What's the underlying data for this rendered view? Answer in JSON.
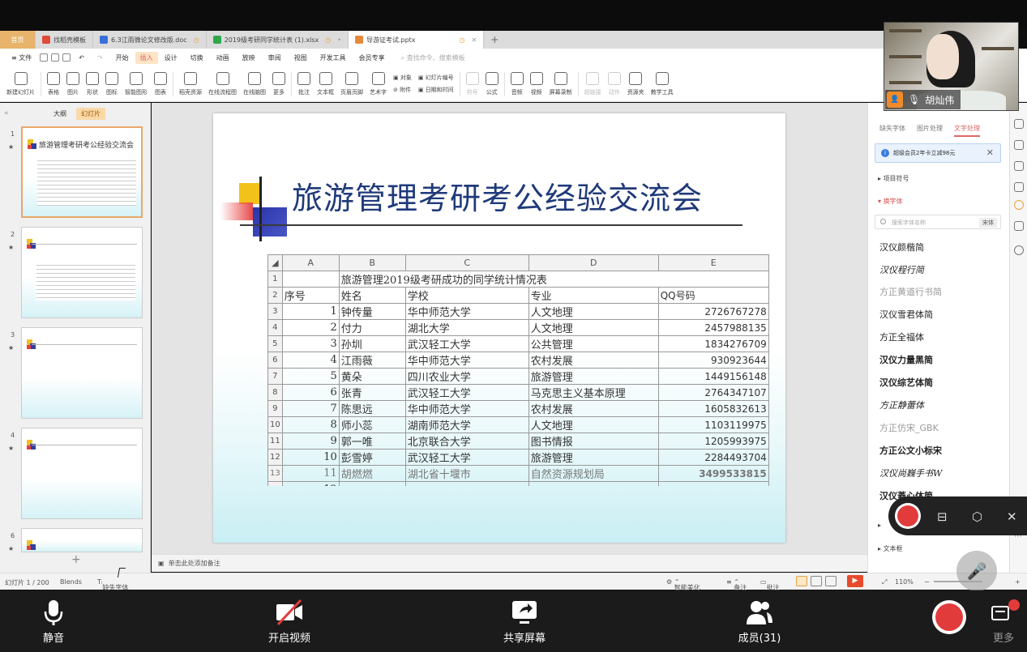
{
  "tabs": [
    {
      "label": "首页",
      "kind": "home"
    },
    {
      "label": "找稻壳模板",
      "kind": "normal"
    },
    {
      "label": "6.3江雨微论文修改版.doc",
      "kind": "normal"
    },
    {
      "label": "2019级考研同学统计表 (1).xlsx",
      "kind": "normal"
    },
    {
      "label": "导游证考试.pptx",
      "kind": "active"
    }
  ],
  "menu": {
    "file": "文件",
    "items": [
      "开始",
      "插入",
      "设计",
      "切换",
      "动画",
      "放映",
      "审阅",
      "视图",
      "开发工具",
      "会员专享"
    ],
    "selected": "插入",
    "search": "查找命令、搜索模板"
  },
  "ribbon": {
    "items": [
      "新建幻灯片",
      "表格",
      "图片",
      "形状",
      "图标",
      "智能图形",
      "图表",
      "稻壳资源",
      "在线流程图",
      "在线脑图",
      "更多",
      "批注",
      "文本框",
      "页眉页脚",
      "艺术字"
    ],
    "small_col1": [
      "对象",
      "附件"
    ],
    "small_col2": [
      "幻灯片编号",
      "日期和时间"
    ],
    "items2": [
      "符号",
      "公式",
      "音频",
      "视频",
      "屏幕录制",
      "超链接",
      "动作",
      "资源夹",
      "教学工具"
    ]
  },
  "left_panel": {
    "tab_outline": "大纲",
    "tab_slides": "幻灯片",
    "thumb_title": "旅游管理考研考公经验交流会",
    "slide_numbers": [
      "1",
      "2",
      "3",
      "4",
      "6"
    ]
  },
  "slide": {
    "title": "旅游管理考研考公经验交流会",
    "sheet": {
      "col_headers": [
        "A",
        "B",
        "C",
        "D",
        "E"
      ],
      "table_title": "旅游管理2019级考研成功的同学统计情况表",
      "headers": [
        "序号",
        "姓名",
        "学校",
        "专业",
        "QQ号码"
      ],
      "rows": [
        {
          "rn": "3",
          "no": "1",
          "name": "钟传量",
          "school": "华中师范大学",
          "major": "人文地理",
          "qq": "2726767278"
        },
        {
          "rn": "4",
          "no": "2",
          "name": "付力",
          "school": "湖北大学",
          "major": "人文地理",
          "qq": "2457988135"
        },
        {
          "rn": "5",
          "no": "3",
          "name": "孙圳",
          "school": "武汉轻工大学",
          "major": "公共管理",
          "qq": "1834276709"
        },
        {
          "rn": "6",
          "no": "4",
          "name": "江雨薇",
          "school": "华中师范大学",
          "major": "农村发展",
          "qq": "930923644"
        },
        {
          "rn": "7",
          "no": "5",
          "name": "黄朵",
          "school": "四川农业大学",
          "major": "旅游管理",
          "qq": "1449156148"
        },
        {
          "rn": "8",
          "no": "6",
          "name": "张青",
          "school": "武汉轻工大学",
          "major": "马克思主义基本原理",
          "qq": "2764347107"
        },
        {
          "rn": "9",
          "no": "7",
          "name": "陈思远",
          "school": "华中师范大学",
          "major": "农村发展",
          "qq": "1605832613"
        },
        {
          "rn": "10",
          "no": "8",
          "name": "师小蕊",
          "school": "湖南师范大学",
          "major": "人文地理",
          "qq": "1103119975"
        },
        {
          "rn": "11",
          "no": "9",
          "name": "郭一唯",
          "school": "北京联合大学",
          "major": "图书情报",
          "qq": "1205993975"
        },
        {
          "rn": "12",
          "no": "10",
          "name": "彭雪婷",
          "school": "武汉轻工大学",
          "major": "旅游管理",
          "qq": "2284493704"
        },
        {
          "rn": "13",
          "no": "11",
          "name": "胡燃燃",
          "school": "湖北省十堰市",
          "major": "自然资源规划局",
          "qq": "3499533815"
        },
        {
          "rn": "14",
          "no": "12",
          "name": "",
          "school": "",
          "major": "",
          "qq": ""
        }
      ]
    }
  },
  "notes_placeholder": "单击此处添加备注",
  "status": {
    "slide_count": "幻灯片 1 / 200",
    "theme": "Blends",
    "missing_font": "缺失字体",
    "smart": "智能美化",
    "notes": "备注",
    "comments": "批注",
    "zoom": "110%"
  },
  "right_panel": {
    "tabs": [
      "缺失字体",
      "图片处理",
      "文字处理"
    ],
    "active_tab": "文字处理",
    "vip_banner": "超级会员2年卡立减98元",
    "section_bullets": "项目符号",
    "section_fonts": "换字体",
    "font_search_placeholder": "搜索字体名称",
    "font_search_btn": "宋体",
    "fonts": [
      "汉仪颜楷简",
      "汉仪程行简",
      "方正黄道行书简",
      "汉仪雪君体简",
      "方正全福体",
      "汉仪力量黑简",
      "汉仪综艺体简",
      "方正静蕾体",
      "方正仿宋_GBK",
      "方正公文小标宋",
      "汉仪尚巍手书W",
      "汉仪菱心体简"
    ],
    "section_textbox": "文本框"
  },
  "video": {
    "name": "胡灿伟"
  },
  "meeting_bar": {
    "mute": "静音",
    "video": "开启视频",
    "share": "共享屏幕",
    "members": "成员(31)",
    "more": "更多",
    "badge_count": "1"
  },
  "colors": {
    "accent": "#e8a86a",
    "title": "#1f3a7a",
    "record": "#e23b3b"
  }
}
